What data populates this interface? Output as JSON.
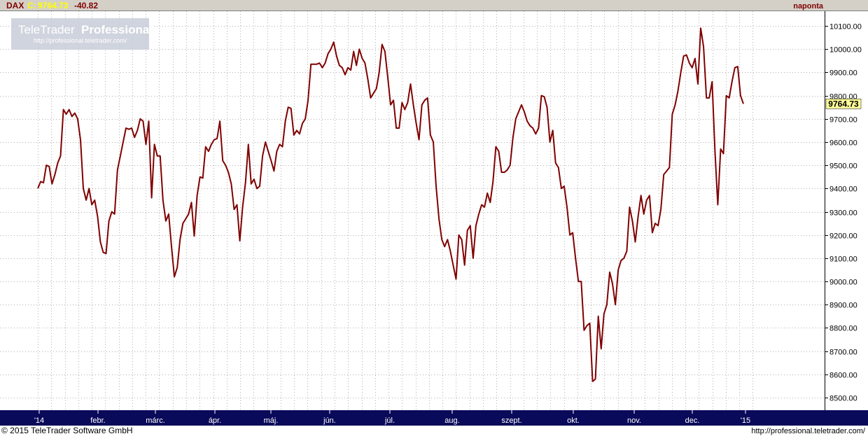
{
  "header": {
    "symbol": "DAX",
    "close_prefix": "C:",
    "close_value": "9764.73",
    "change": "-40.82",
    "period_label": "naponta"
  },
  "watermark": {
    "brand_plain": "TeleTrader",
    "brand_bold": "Professional",
    "url": "http://professional.teletrader.com/"
  },
  "footer": {
    "copyright": "© 2015 TeleTrader Software GmbH",
    "url": "http://professional.teletrader.com/"
  },
  "colors": {
    "line": "#800000",
    "axis_bg": "#0a0a5a",
    "header_bg": "#d4d0c8",
    "last_value_box": "#ffff99",
    "grid": "#b0b0b0"
  },
  "chart_data": {
    "type": "line",
    "series_name": "DAX",
    "ylim": [
      8450,
      10150
    ],
    "yticks": [
      8500,
      8600,
      8700,
      8800,
      8900,
      9000,
      9100,
      9200,
      9300,
      9400,
      9500,
      9600,
      9700,
      9800,
      9900,
      10000,
      10100
    ],
    "ytick_labels": [
      "8500.00",
      "8600.00",
      "8700.00",
      "8800.00",
      "8900.00",
      "9000.00",
      "9100.00",
      "9200.00",
      "9300.00",
      "9400.00",
      "9500.00",
      "9600.00",
      "9700.00",
      "9800.00",
      "9900.00",
      "10000.00",
      "10100.00"
    ],
    "x_months": [
      "'14",
      "febr.",
      "márc.",
      "ápr.",
      "máj.",
      "jún.",
      "júl.",
      "aug.",
      "szept.",
      "okt.",
      "nov.",
      "dec.",
      "'15"
    ],
    "last_value_label": "9764.73",
    "grid": true,
    "values": [
      9400,
      9430,
      9425,
      9500,
      9495,
      9420,
      9460,
      9510,
      9540,
      9740,
      9720,
      9740,
      9710,
      9725,
      9700,
      9610,
      9400,
      9350,
      9400,
      9330,
      9350,
      9280,
      9170,
      9125,
      9120,
      9260,
      9300,
      9290,
      9480,
      9540,
      9600,
      9660,
      9655,
      9660,
      9620,
      9650,
      9700,
      9690,
      9590,
      9690,
      9360,
      9590,
      9540,
      9540,
      9350,
      9260,
      9290,
      9150,
      9020,
      9060,
      9180,
      9250,
      9270,
      9290,
      9340,
      9195,
      9370,
      9450,
      9445,
      9580,
      9560,
      9590,
      9610,
      9615,
      9690,
      9520,
      9500,
      9470,
      9420,
      9310,
      9330,
      9175,
      9320,
      9425,
      9590,
      9420,
      9440,
      9400,
      9410,
      9540,
      9600,
      9560,
      9520,
      9475,
      9560,
      9590,
      9580,
      9690,
      9750,
      9745,
      9630,
      9650,
      9635,
      9680,
      9700,
      9780,
      9935,
      9935,
      9935,
      9940,
      9920,
      9940,
      9980,
      10000,
      10030,
      9970,
      9930,
      9920,
      9890,
      9920,
      9910,
      9990,
      9930,
      10000,
      9960,
      9940,
      9870,
      9790,
      9810,
      9830,
      9900,
      10020,
      9990,
      9880,
      9760,
      9780,
      9660,
      9660,
      9770,
      9740,
      9770,
      9850,
      9760,
      9680,
      9610,
      9760,
      9780,
      9790,
      9630,
      9600,
      9410,
      9270,
      9180,
      9150,
      9180,
      9130,
      9070,
      9010,
      9200,
      9180,
      9070,
      9220,
      9240,
      9100,
      9240,
      9290,
      9330,
      9320,
      9380,
      9340,
      9430,
      9580,
      9560,
      9470,
      9470,
      9480,
      9500,
      9620,
      9700,
      9730,
      9760,
      9730,
      9690,
      9670,
      9660,
      9635,
      9660,
      9800,
      9795,
      9750,
      9600,
      9650,
      9510,
      9490,
      9400,
      9410,
      9320,
      9200,
      9210,
      9100,
      9000,
      9000,
      8790,
      8810,
      8820,
      8570,
      8580,
      8850,
      8710,
      8860,
      8900,
      9040,
      8990,
      8900,
      9050,
      9090,
      9100,
      9130,
      9320,
      9260,
      9170,
      9280,
      9370,
      9290,
      9350,
      9370,
      9210,
      9250,
      9240,
      9310,
      9460,
      9475,
      9490,
      9720,
      9760,
      9820,
      9900,
      9970,
      9975,
      9940,
      9920,
      9960,
      9850,
      10090,
      10010,
      9790,
      9790,
      9860,
      9560,
      9330,
      9570,
      9550,
      9800,
      9790,
      9860,
      9920,
      9925,
      9800,
      9764.73
    ]
  }
}
